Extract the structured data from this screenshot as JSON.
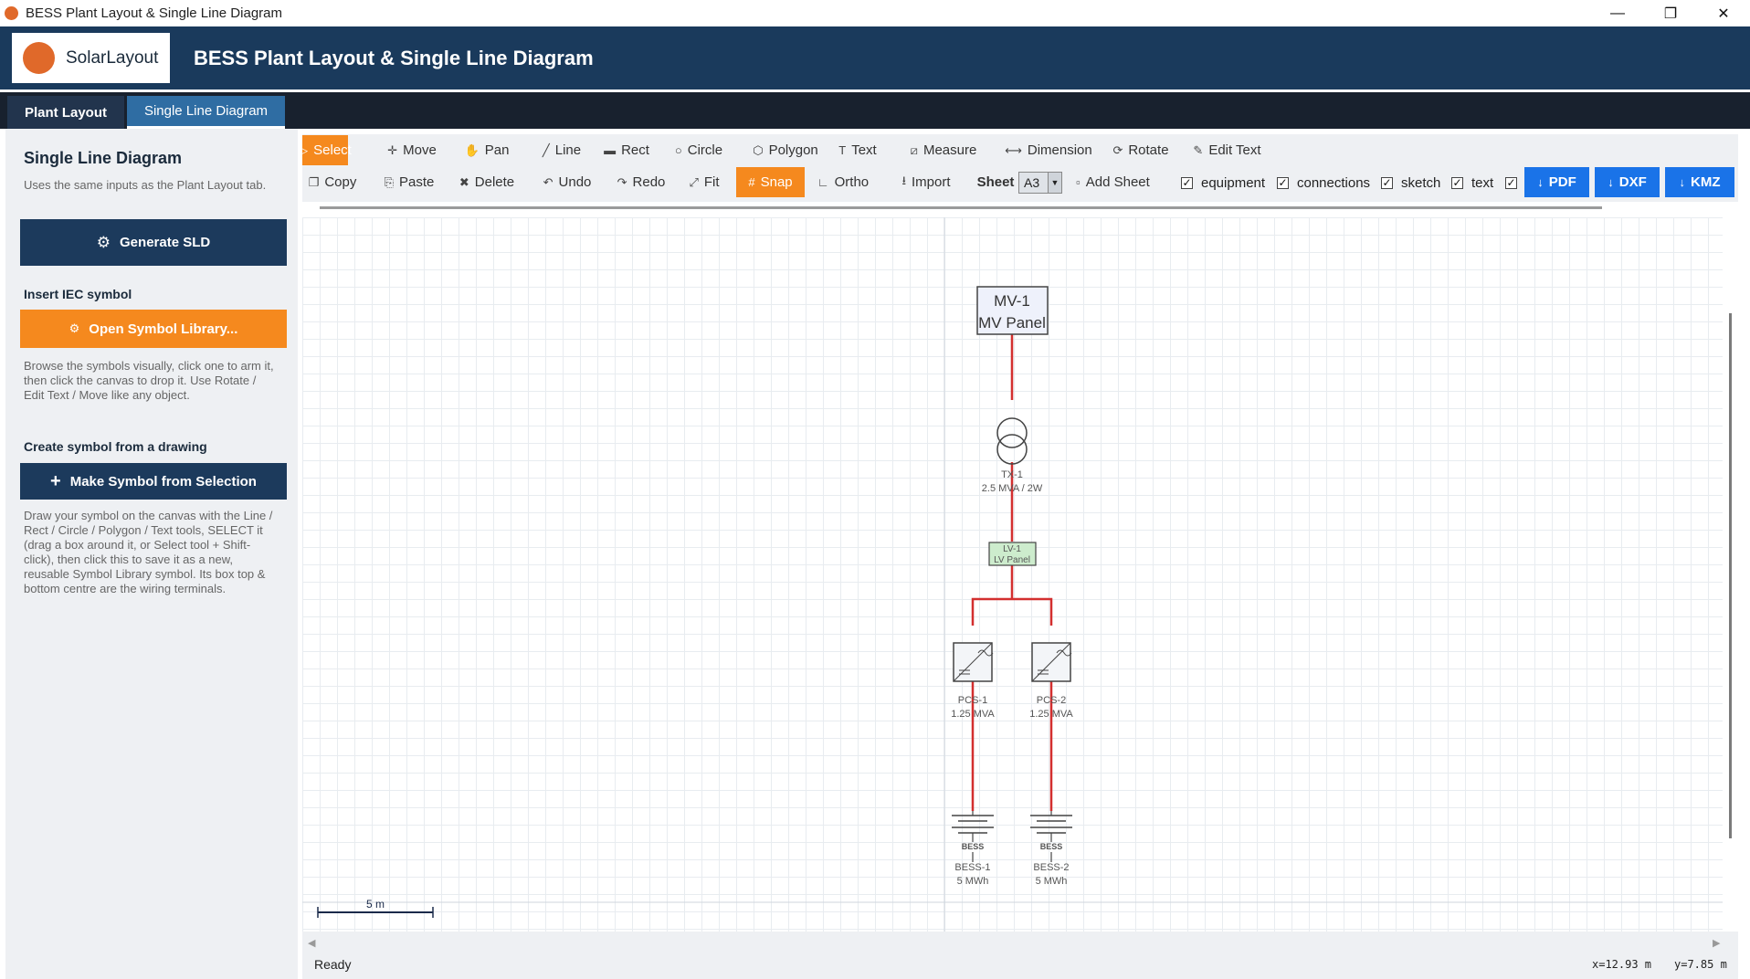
{
  "window": {
    "title": "BESS Plant Layout & Single Line Diagram",
    "controls": [
      "—",
      "❐",
      "✕"
    ]
  },
  "header": {
    "logo_text": "SolarLayout",
    "title": "BESS Plant Layout & Single Line Diagram"
  },
  "tabs": [
    {
      "label": "Plant Layout",
      "active": false
    },
    {
      "label": "Single Line Diagram",
      "active": true
    }
  ],
  "sidebar": {
    "heading": "Single Line Diagram",
    "intro": "Uses the same inputs as the Plant Layout tab.",
    "generate_button": "Generate SLD",
    "insert_heading": "Insert IEC symbol",
    "library_button": "Open Symbol Library...",
    "library_help": "Browse the symbols visually, click one to arm it, then click the canvas to drop it. Use Rotate / Edit Text / Move like any object.",
    "create_heading": "Create symbol from a drawing",
    "make_symbol_button": "Make Symbol from Selection",
    "make_symbol_help": "Draw your symbol on the canvas with the Line / Rect / Circle / Polygon / Text tools, SELECT it (drag a box around it, or Select tool + Shift-click), then click this to save it as a new, reusable Symbol Library symbol. Its box top & bottom centre are the wiring terminals."
  },
  "toolbar": {
    "row1": [
      {
        "label": "Select",
        "icon": "cursor-icon",
        "glyph": "▷",
        "active": true
      },
      {
        "label": "Move",
        "icon": "move-icon",
        "glyph": "✛"
      },
      {
        "label": "Pan",
        "icon": "hand-icon",
        "glyph": "✋"
      },
      {
        "label": "Line",
        "icon": "line-icon",
        "glyph": "╱"
      },
      {
        "label": "Rect",
        "icon": "rect-icon",
        "glyph": "▬"
      },
      {
        "label": "Circle",
        "icon": "circle-icon",
        "glyph": "○"
      },
      {
        "label": "Polygon",
        "icon": "polygon-icon",
        "glyph": "⬡"
      },
      {
        "label": "Text",
        "icon": "text-icon",
        "glyph": "T"
      },
      {
        "label": "Measure",
        "icon": "ruler-icon",
        "glyph": "⧄"
      },
      {
        "label": "Dimension",
        "icon": "dimension-icon",
        "glyph": "⟷"
      },
      {
        "label": "Rotate",
        "icon": "rotate-icon",
        "glyph": "⟳"
      },
      {
        "label": "Edit Text",
        "icon": "pencil-icon",
        "glyph": "✎"
      }
    ],
    "row2": [
      {
        "label": "Copy",
        "icon": "copy-icon",
        "glyph": "❐"
      },
      {
        "label": "Paste",
        "icon": "paste-icon",
        "glyph": "⎘"
      },
      {
        "label": "Delete",
        "icon": "trash-icon",
        "glyph": "✖"
      },
      {
        "label": "Undo",
        "icon": "undo-icon",
        "glyph": "↶"
      },
      {
        "label": "Redo",
        "icon": "redo-icon",
        "glyph": "↷"
      },
      {
        "label": "Fit",
        "icon": "fit-icon",
        "glyph": "⤢"
      },
      {
        "label": "Snap",
        "icon": "grid-icon",
        "glyph": "#",
        "active": true
      },
      {
        "label": "Ortho",
        "icon": "ortho-icon",
        "glyph": "∟"
      },
      {
        "label": "Import",
        "icon": "import-icon",
        "glyph": "⭳"
      }
    ],
    "sheet_label": "Sheet",
    "sheet_value": "A3",
    "add_sheet": "Add Sheet",
    "layers": [
      "equipment",
      "connections",
      "sketch",
      "text",
      ""
    ],
    "exports": [
      "PDF",
      "DXF",
      "KMZ"
    ]
  },
  "diagram": {
    "mv_panel": {
      "line1": "MV-1",
      "line2": "MV Panel"
    },
    "transformer": {
      "name": "TX-1",
      "rating": "2.5 MVA / 2W"
    },
    "lv_panel": {
      "line1": "LV-1",
      "line2": "LV Panel"
    },
    "pcs": [
      {
        "name": "PCS-1",
        "rating": "1.25 MVA"
      },
      {
        "name": "PCS-2",
        "rating": "1.25 MVA"
      }
    ],
    "bess": [
      {
        "tag": "BESS",
        "name": "BESS-1",
        "energy": "5 MWh"
      },
      {
        "tag": "BESS",
        "name": "BESS-2",
        "energy": "5 MWh"
      }
    ],
    "scale_label": "5 m",
    "colors": {
      "connection": "#d32f2f",
      "equipment": "#444444",
      "panel_fill": "#eef1fb",
      "lv_fill": "#cdeccd"
    }
  },
  "status": {
    "text": "Ready",
    "x": "x=12.93 m",
    "y": "y=7.85 m"
  }
}
